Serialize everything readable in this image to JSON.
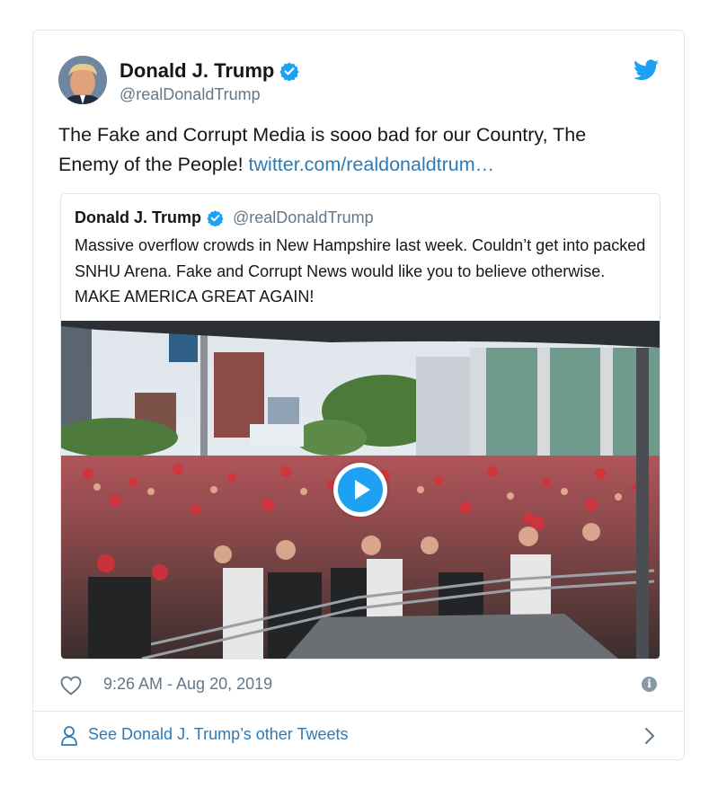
{
  "tweet": {
    "author_name": "Donald J. Trump",
    "author_handle": "@realDonaldTrump",
    "text": "The Fake and Corrupt Media is sooo bad for our Country, The Enemy of the People! ",
    "link_text": "twitter.com/realdonaldtrum…",
    "timestamp": "9:26 AM - Aug 20, 2019"
  },
  "quoted_tweet": {
    "author_name": "Donald J. Trump",
    "author_handle": "@realDonaldTrump",
    "text": "Massive overflow crowds in New Hampshire last week. Couldn’t get into packed SNHU Arena. Fake and Corrupt News would like you to believe otherwise. MAKE AMERICA GREAT AGAIN!"
  },
  "footer": {
    "label": "See Donald J. Trump’s other Tweets"
  },
  "icons": {
    "brand": "twitter-bird-icon",
    "verified": "verified-badge-icon",
    "like": "heart-icon",
    "info": "info-icon",
    "profile": "person-icon",
    "play": "play-icon",
    "more": "chevron-right-icon"
  },
  "colors": {
    "twitter_blue": "#1da1f2",
    "link_blue": "#2b7bb9",
    "secondary_text": "#657786",
    "border": "#e1e8ed"
  }
}
